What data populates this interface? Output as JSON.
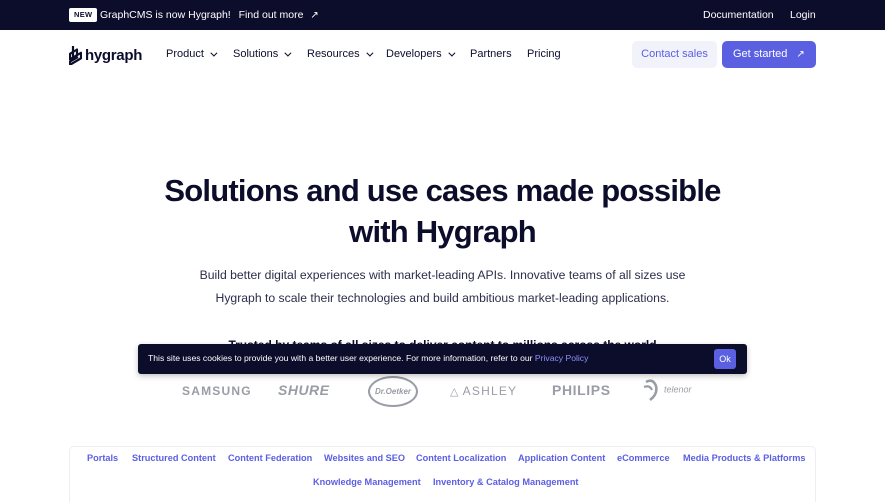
{
  "announcement": {
    "badge": "NEW",
    "message": "GraphCMS is now Hygraph!",
    "cta": "Find out more",
    "links": [
      "Documentation",
      "Login"
    ]
  },
  "header": {
    "logo_text": "hygraph",
    "nav": [
      {
        "label": "Product",
        "dropdown": true
      },
      {
        "label": "Solutions",
        "dropdown": true
      },
      {
        "label": "Resources",
        "dropdown": true
      },
      {
        "label": "Developers",
        "dropdown": true
      },
      {
        "label": "Partners",
        "dropdown": false
      },
      {
        "label": "Pricing",
        "dropdown": false
      }
    ],
    "contact_sales": "Contact sales",
    "get_started": "Get started"
  },
  "hero": {
    "title_line1": "Solutions and use cases made possible",
    "title_line2": "with Hygraph",
    "subtitle_line1": "Build better digital experiences with market-leading APIs. Innovative teams of all sizes use",
    "subtitle_line2": "Hygraph to scale their technologies and build ambitious market-leading applications.",
    "trusted_text": "Trusted by teams of all sizes to deliver content to millions across the world"
  },
  "logos": [
    "SAMSUNG",
    "SHURE",
    "Dr.Oetker",
    "ASHLEY",
    "PHILIPS",
    "telenor"
  ],
  "cookie_banner": {
    "text": "This site uses cookies to provide you with a better user experience. For more information, refer to our",
    "link": "Privacy Policy",
    "button": "Ok"
  },
  "tabs": [
    "Portals",
    "Structured Content",
    "Content Federation",
    "Websites and SEO",
    "Content Localization",
    "Application Content",
    "eCommerce",
    "Media Products & Platforms",
    "Knowledge Management",
    "Inventory & Catalog Management"
  ],
  "colors": {
    "navy": "#0c0d2b",
    "accent": "#5b5fe2",
    "accent_light": "#f2f2fb",
    "logo_grey": "#9a9ca6"
  }
}
